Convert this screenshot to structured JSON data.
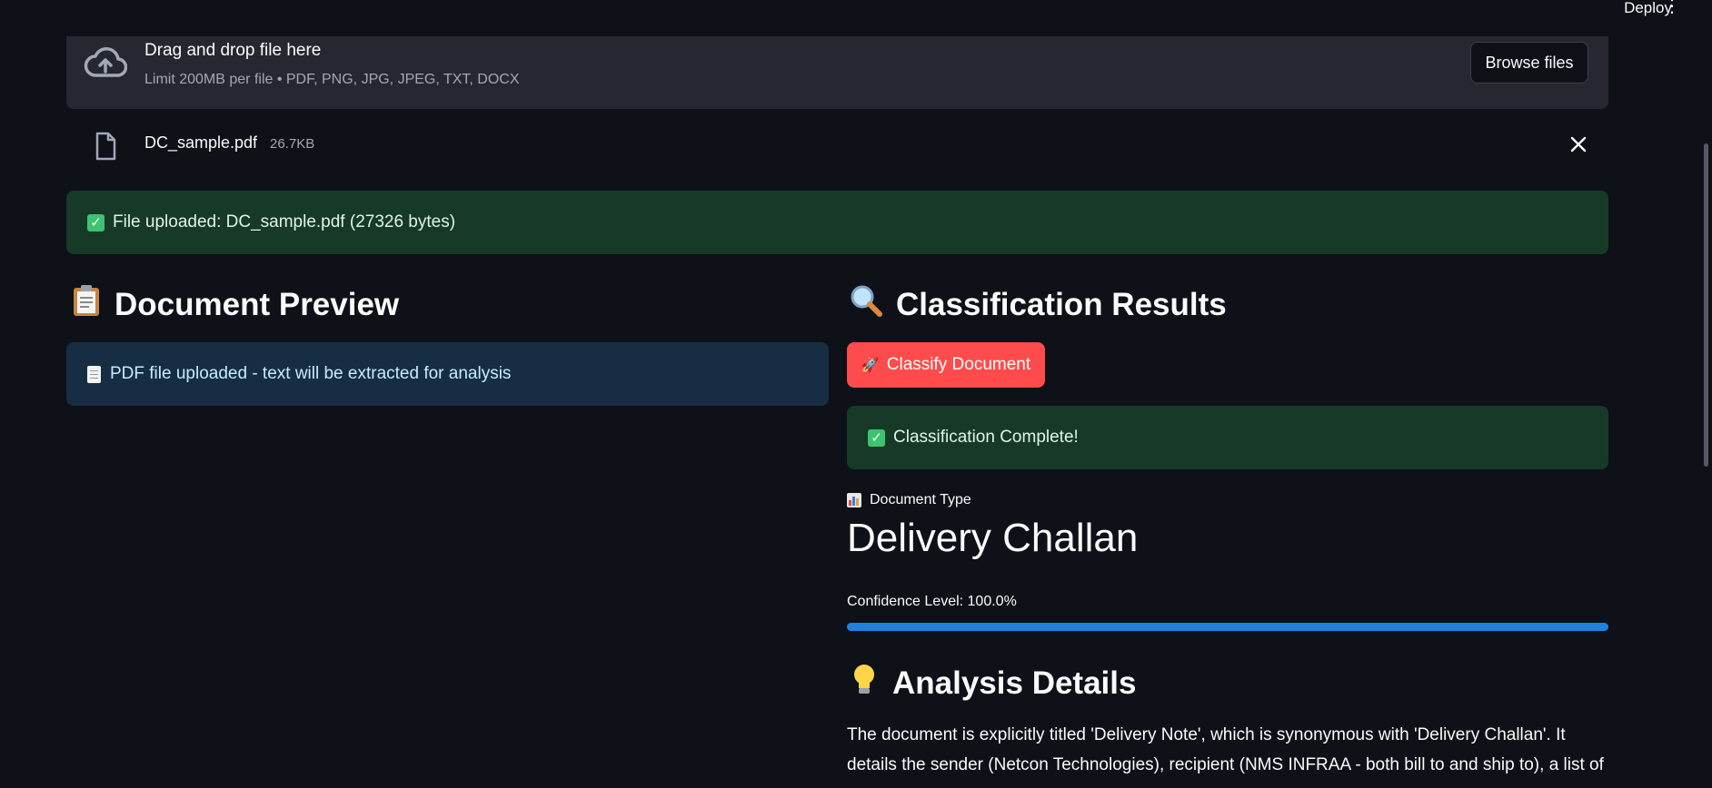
{
  "topbar": {
    "deploy_label": "Deploy",
    "menu_icon": "kebab-menu-icon"
  },
  "uploader": {
    "title": "Drag and drop file here",
    "subtitle": "Limit 200MB per file • PDF, PNG, JPG, JPEG, TXT, DOCX",
    "browse_label": "Browse files",
    "icon": "cloud-upload-icon"
  },
  "file": {
    "name": "DC_sample.pdf",
    "size": "26.7KB",
    "icon": "file-icon",
    "remove_icon": "close-icon"
  },
  "upload_success": {
    "text": "File uploaded: DC_sample.pdf (27326 bytes)"
  },
  "preview": {
    "heading": "Document Preview",
    "info_text": "PDF file uploaded - text will be extracted for analysis"
  },
  "results": {
    "heading": "Classification Results",
    "classify_label": "Classify Document",
    "complete_text": "Classification Complete!",
    "metric_label": "Document Type",
    "metric_value": "Delivery Challan",
    "confidence_label": "Confidence Level: 100.0%",
    "confidence": 1.0
  },
  "analysis": {
    "heading": "Analysis Details",
    "text": "The document is explicitly titled 'Delivery Note', which is synonymous with 'Delivery Challan'. It details the sender (Netcon Technologies), recipient (NMS INFRAA - both bill to and ship to), a list of"
  },
  "colors": {
    "background": "#0e1117",
    "primary": "#ff4b4b",
    "success_bg": "#173928",
    "info_bg": "#172d43",
    "progress": "#1c83e1"
  }
}
